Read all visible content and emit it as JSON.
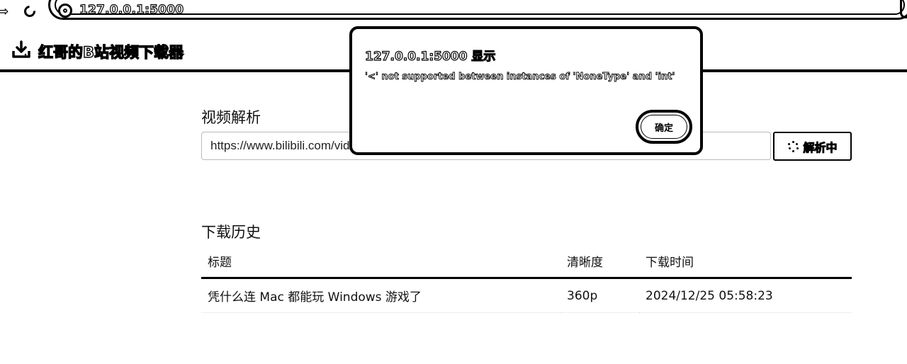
{
  "browser": {
    "url": "127.0.0.1:5000"
  },
  "header": {
    "title": "红哥的B站视频下载器",
    "logo_icon": "download-icon"
  },
  "parse_section": {
    "title": "视频解析",
    "input_value": "https://www.bilibili.com/video/BV1xx?spm_id_from=333.1007.tianma.1-1-1.click&vd_source=",
    "button_label": "解析中"
  },
  "history": {
    "title": "下载历史",
    "columns": [
      "标题",
      "清晰度",
      "下载时间"
    ],
    "rows": [
      {
        "title": "凭什么连 Mac 都能玩 Windows 游戏了",
        "quality": "360p",
        "time": "2024/12/25 05:58:23"
      }
    ]
  },
  "dialog": {
    "title": "127.0.0.1:5000 显示",
    "message": "'<' not supported between instances of 'NoneType' and 'int'",
    "ok_label": "确定"
  }
}
